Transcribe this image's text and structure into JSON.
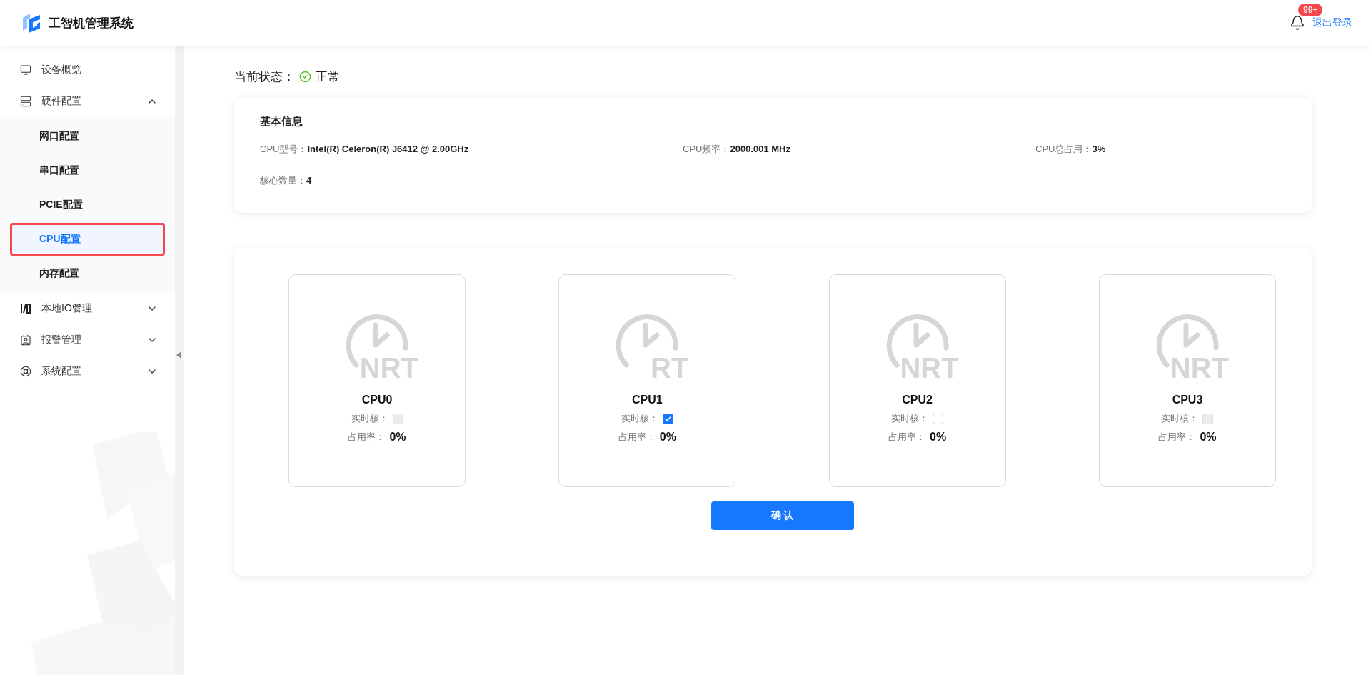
{
  "header": {
    "title": "工智机管理系统",
    "notification_badge": "99+",
    "logout": "退出登录"
  },
  "sidebar": {
    "items": [
      {
        "label": "设备概览",
        "kind": "link"
      },
      {
        "label": "硬件配置",
        "kind": "group",
        "expanded": true,
        "children": [
          {
            "label": "网口配置",
            "selected": false
          },
          {
            "label": "串口配置",
            "selected": false
          },
          {
            "label": "PCIE配置",
            "selected": false
          },
          {
            "label": "CPU配置",
            "selected": true
          },
          {
            "label": "内存配置",
            "selected": false
          }
        ]
      },
      {
        "label": "本地IO管理",
        "kind": "group",
        "expanded": false
      },
      {
        "label": "报警管理",
        "kind": "group",
        "expanded": false
      },
      {
        "label": "系统配置",
        "kind": "group",
        "expanded": false
      }
    ]
  },
  "status": {
    "label": "当前状态：",
    "value": "正常"
  },
  "basic_info": {
    "title": "基本信息",
    "fields": [
      {
        "label": "CPU型号：",
        "value": "Intel(R) Celeron(R) J6412 @ 2.00GHz"
      },
      {
        "label": "CPU频率：",
        "value": "2000.001 MHz"
      },
      {
        "label": "CPU总占用：",
        "value": "3%"
      },
      {
        "label": "核心数量：",
        "value": "4"
      }
    ]
  },
  "cpus": [
    {
      "name": "CPU0",
      "mode": "NRT",
      "realtime_label": "实时核：",
      "checked": false,
      "disabled": true,
      "usage_label": "占用率：",
      "usage": "0%"
    },
    {
      "name": "CPU1",
      "mode": "RT",
      "realtime_label": "实时核：",
      "checked": true,
      "disabled": false,
      "usage_label": "占用率：",
      "usage": "0%"
    },
    {
      "name": "CPU2",
      "mode": "NRT",
      "realtime_label": "实时核：",
      "checked": false,
      "disabled": false,
      "usage_label": "占用率：",
      "usage": "0%"
    },
    {
      "name": "CPU3",
      "mode": "NRT",
      "realtime_label": "实时核：",
      "checked": false,
      "disabled": true,
      "usage_label": "占用率：",
      "usage": "0%"
    }
  ],
  "confirm_button": "确 认"
}
